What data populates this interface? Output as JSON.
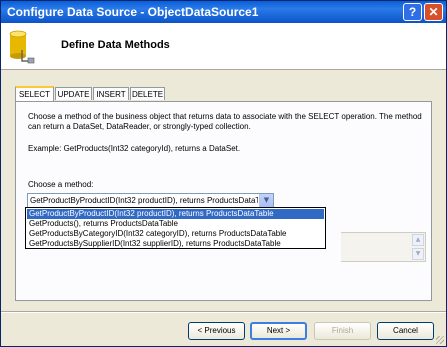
{
  "window": {
    "title": "Configure Data Source - ObjectDataSource1",
    "help_label": "?",
    "close_label": "✕"
  },
  "header": {
    "title": "Define Data Methods",
    "icon": "database-icon"
  },
  "tabs": [
    {
      "label": "SELECT",
      "active": true
    },
    {
      "label": "UPDATE",
      "active": false
    },
    {
      "label": "INSERT",
      "active": false
    },
    {
      "label": "DELETE",
      "active": false
    }
  ],
  "select_panel": {
    "description": "Choose a method of the business object that returns data to associate with the SELECT operation. The method can return a DataSet, DataReader, or strongly-typed collection.",
    "example": "Example: GetProducts(Int32 categoryId), returns a DataSet.",
    "choose_label": "Choose a method:",
    "selected_method": "GetProductByProductID(Int32 productID), returns ProductsDataTable",
    "options": [
      "GetProductByProductID(Int32 productID), returns ProductsDataTable",
      "GetProducts(), returns ProductsDataTable",
      "GetProductsByCategoryID(Int32 categoryID), returns ProductsDataTable",
      "GetProductsBySupplierID(Int32 supplierID), returns ProductsDataTable"
    ]
  },
  "buttons": {
    "previous": "< Previous",
    "next": "Next >",
    "finish": "Finish",
    "cancel": "Cancel"
  },
  "colors": {
    "title_bar": "#0a5fd8",
    "selection": "#316ac5",
    "dialog_bg": "#ece9d8",
    "active_tab_accent": "#ffc83c"
  }
}
